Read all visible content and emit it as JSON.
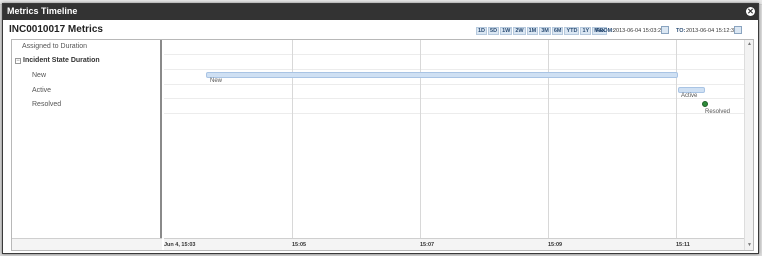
{
  "window": {
    "title": "Metrics Timeline"
  },
  "header": {
    "incident_title": "INC0010017 Metrics",
    "zoom_buttons": [
      "1D",
      "5D",
      "1W",
      "2W",
      "1M",
      "3M",
      "6M",
      "YTD",
      "1Y",
      "Max"
    ],
    "from_label": "FROM:",
    "from_value": "2013-06-04 15:03:25",
    "to_label": "TO:",
    "to_value": "2013-06-04 15:12:32"
  },
  "rows": {
    "assigned": "Assigned to Duration",
    "group": "Incident State Duration",
    "group_toggle": "−",
    "new": "New",
    "active": "Active",
    "resolved": "Resolved"
  },
  "axis": {
    "ticks": [
      "Jun 4, 15:03",
      "15:05",
      "15:07",
      "15:09",
      "15:11"
    ]
  },
  "timeline": {
    "new_label": "New",
    "active_label": "Active",
    "resolved_label": "Resolved"
  },
  "colors": {
    "titlebar": "#333333",
    "bar": "#cfe0f3",
    "resolved_dot": "#2e8b3a"
  }
}
